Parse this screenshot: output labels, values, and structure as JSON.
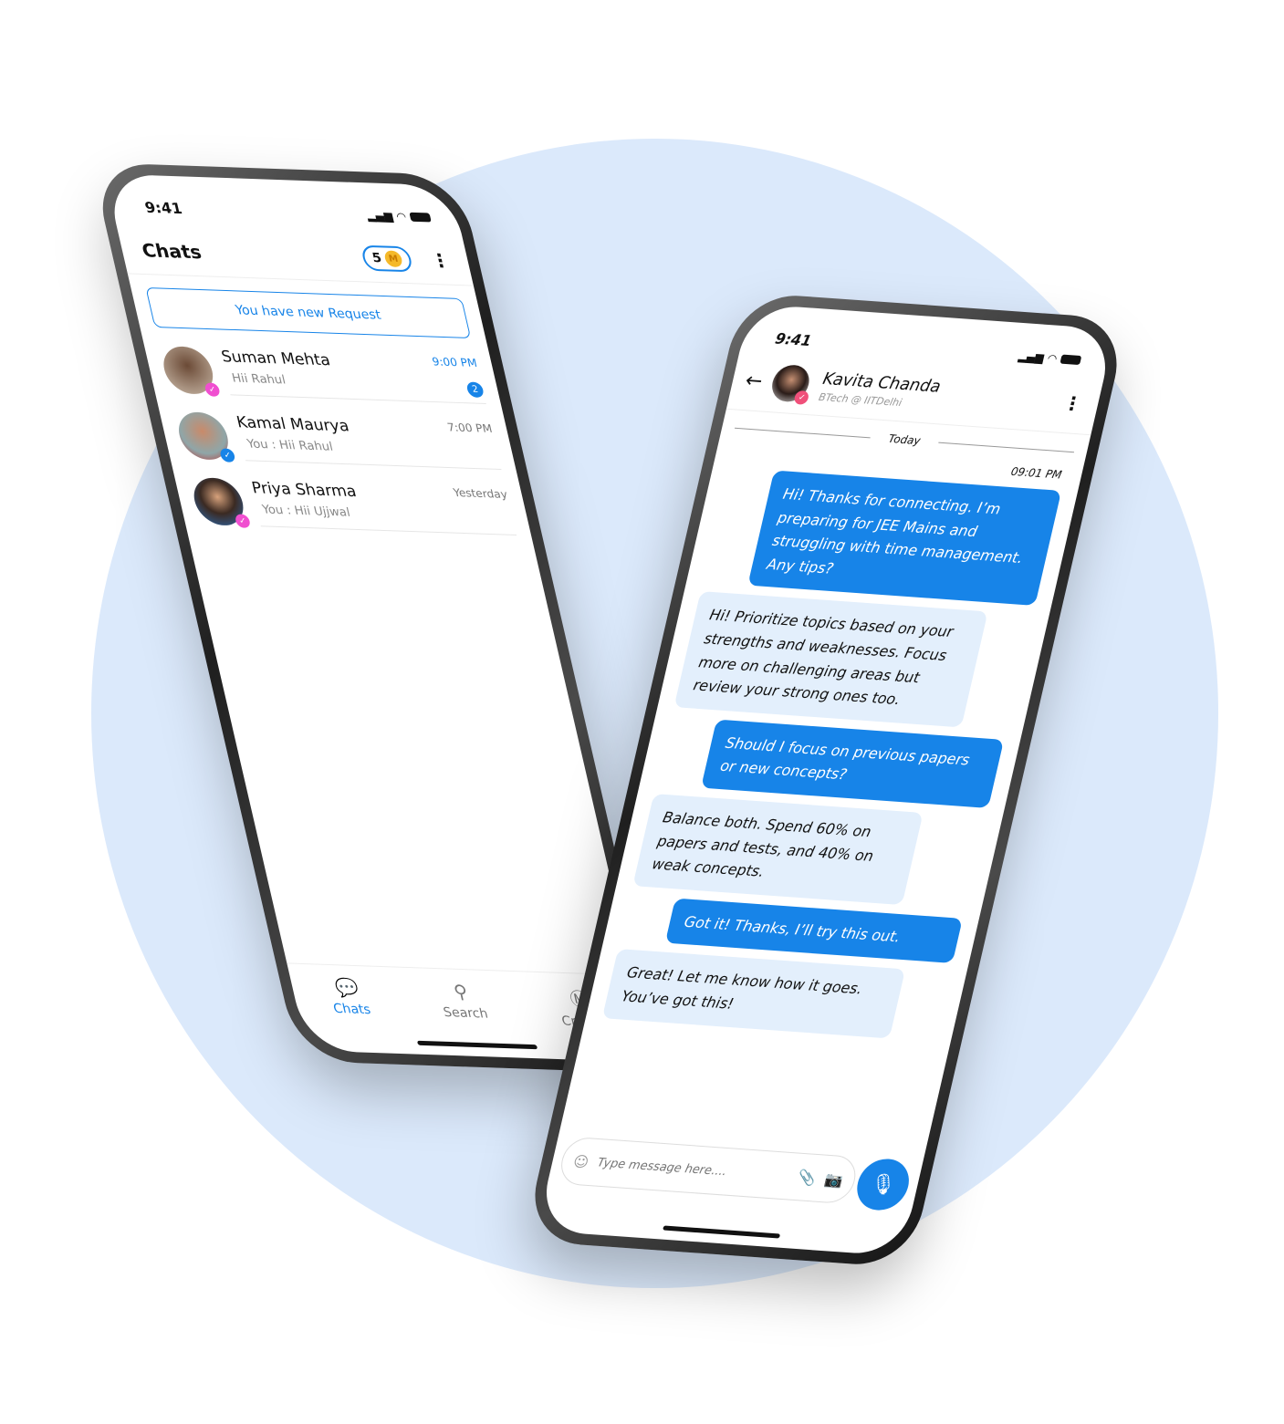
{
  "colors": {
    "accent": "#1784e8",
    "received_bubble": "#e3effc",
    "background_circle": "#dbe9fb",
    "verified_pink": "#f04fd0",
    "verified_blue": "#1784e8"
  },
  "chat_list": {
    "status_time": "9:41",
    "title": "Chats",
    "coins": "5",
    "coin_letter": "M",
    "request_label": "You have new Request",
    "items": [
      {
        "name": "Suman Mehta",
        "message": "Hii Rahul",
        "time": "9:00 PM",
        "unread": "2",
        "verified": "pink"
      },
      {
        "name": "Kamal Maurya",
        "message": "You : Hii Rahul",
        "time": "7:00 PM",
        "verified": "blue"
      },
      {
        "name": "Priya Sharma",
        "message": "You : Hii Ujjwal",
        "time": "Yesterday",
        "verified": "pink"
      }
    ],
    "nav": [
      {
        "label": "Chats",
        "icon": "chat-bubbles-icon",
        "active": true
      },
      {
        "label": "Search",
        "icon": "search-icon"
      },
      {
        "label": "Credits",
        "icon": "credits-coin-icon"
      }
    ]
  },
  "conversation": {
    "status_time": "9:41",
    "contact_name": "Kavita Chanda",
    "contact_subtitle": "BTech @ IITDelhi",
    "day_label": "Today",
    "first_time": "09:01 PM",
    "messages": [
      {
        "from": "me",
        "text": "Hi! Thanks for connecting. I’m preparing for JEE Mains and struggling with time management. Any tips?"
      },
      {
        "from": "them",
        "text": "Hi! Prioritize topics based on your strengths and weaknesses. Focus more on challenging areas but review your strong ones too."
      },
      {
        "from": "me",
        "text": "Should I focus on previous papers or new concepts?"
      },
      {
        "from": "them",
        "text": "Balance both. Spend 60% on papers and tests, and 40% on weak concepts."
      },
      {
        "from": "me",
        "text": "Got it! Thanks, I’ll try this out."
      },
      {
        "from": "them",
        "text": "Great! Let me know how it goes. You’ve got this!"
      }
    ],
    "input_placeholder": "Type message here...."
  }
}
